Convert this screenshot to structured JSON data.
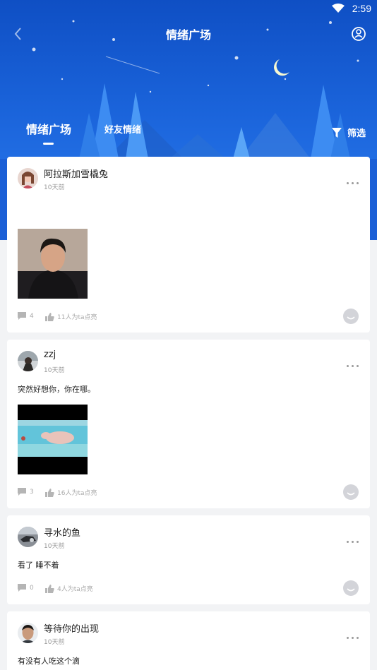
{
  "status": {
    "time": "2:59"
  },
  "nav": {
    "title": "情绪广场"
  },
  "tabs": [
    {
      "label": "情绪广场"
    },
    {
      "label": "好友情绪"
    }
  ],
  "filter": {
    "label": "筛选"
  },
  "posts": [
    {
      "name": "阿拉斯加雪橇兔",
      "time": "10天前",
      "text": "",
      "image": "selfie-photo",
      "comments": "4",
      "likes": "11人为ta点亮"
    },
    {
      "name": "zzj",
      "time": "10天前",
      "text": "突然好想你，你在哪。",
      "image": "pig-in-sea-photo",
      "comments": "3",
      "likes": "16人为ta点亮"
    },
    {
      "name": "寻水的鱼",
      "time": "10天前",
      "text": "看了 睡不着",
      "image": null,
      "comments": "0",
      "likes": "4人为ta点亮"
    },
    {
      "name": "等待你的出现",
      "time": "10天前",
      "text": "有没有人吃这个滴",
      "image": null,
      "comments": "",
      "likes": ""
    }
  ],
  "colors": {
    "hero_top": "#0f4fc4",
    "hero_bottom": "#2b7cf0",
    "card": "#ffffff",
    "bg": "#f2f3f5"
  }
}
